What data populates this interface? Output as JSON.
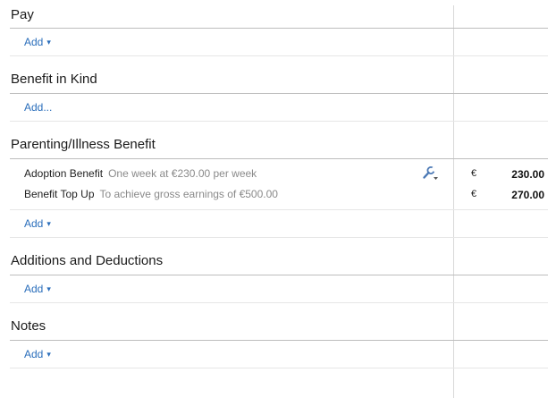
{
  "sections": [
    {
      "title": "Pay",
      "add_label": "Add",
      "add_caret": "▾"
    },
    {
      "title": "Benefit in Kind",
      "add_label": "Add..."
    },
    {
      "title": "Parenting/Illness Benefit",
      "add_label": "Add",
      "add_caret": "▾"
    },
    {
      "title": "Additions and Deductions",
      "add_label": "Add",
      "add_caret": "▾"
    },
    {
      "title": "Notes",
      "add_label": "Add",
      "add_caret": "▾"
    }
  ],
  "benefit_rows": [
    {
      "name": "Adoption Benefit",
      "description": "One week at €230.00 per week",
      "currency": "€",
      "amount": "230.00"
    },
    {
      "name": "Benefit Top Up",
      "description": "To achieve gross earnings of €500.00",
      "currency": "€",
      "amount": "270.00"
    }
  ],
  "icons": {
    "row_tool": "wrench-dropdown-icon"
  },
  "colors": {
    "link": "#2a6ebb",
    "muted_text": "#8a8a8a"
  }
}
